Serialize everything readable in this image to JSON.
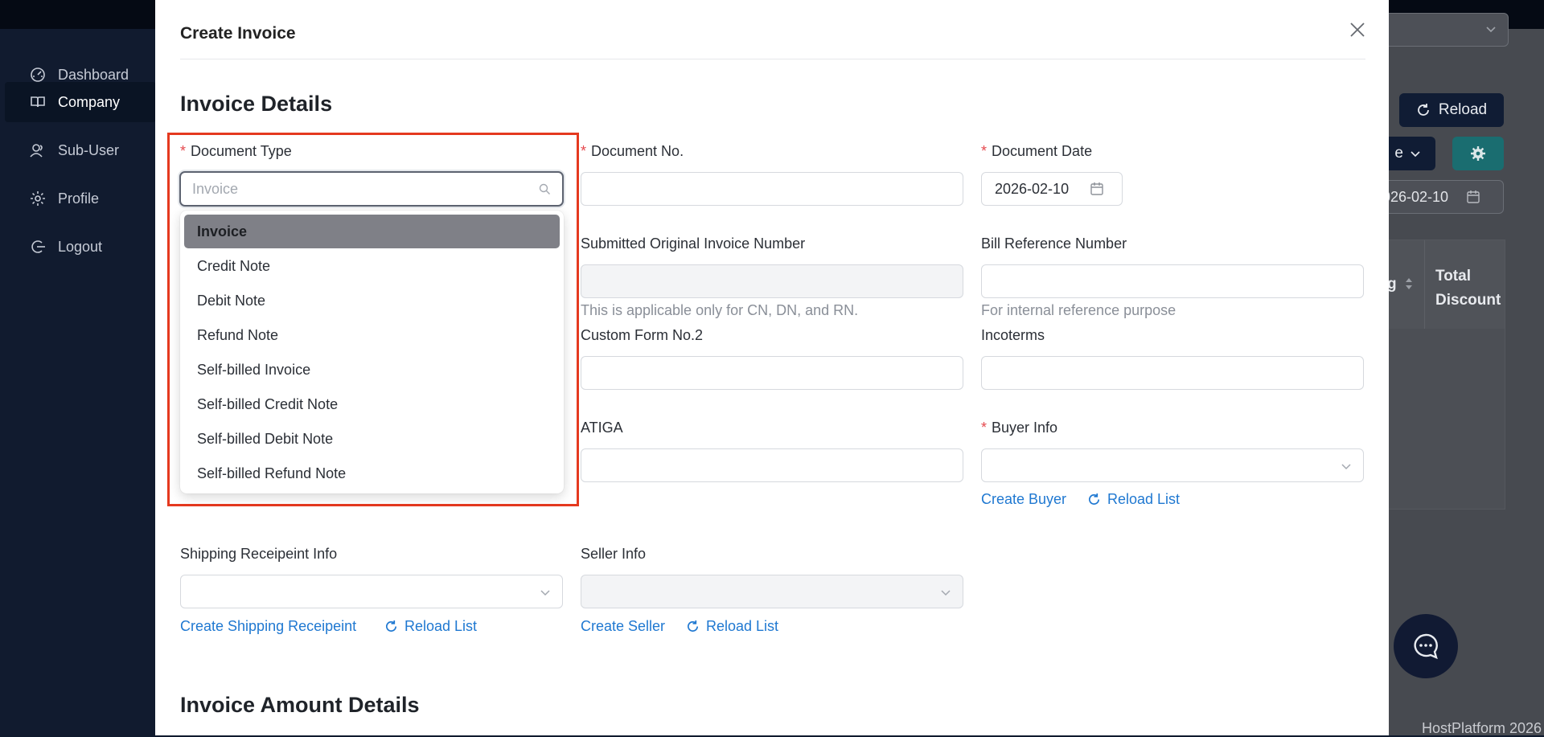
{
  "sidebar": {
    "items": [
      {
        "label": "Dashboard",
        "icon": "dashboard-icon"
      },
      {
        "label": "Company",
        "icon": "book-icon"
      },
      {
        "label": "Sub-User",
        "icon": "users-icon"
      },
      {
        "label": "Profile",
        "icon": "gear-icon"
      },
      {
        "label": "Logout",
        "icon": "logout-icon"
      }
    ],
    "active_index": 1
  },
  "background": {
    "reload_label": "Reload",
    "button_partial_label": "e",
    "date_partial": "026-02-10",
    "table_header_partial": "g",
    "table_header_total_discount": "Total Discount",
    "footer_text": "HostPlatform 2026"
  },
  "modal": {
    "title": "Create Invoice",
    "section_details": "Invoice Details",
    "section_amount": "Invoice Amount Details",
    "document_type": {
      "label": "Document Type",
      "placeholder": "Invoice",
      "options": [
        "Invoice",
        "Credit Note",
        "Debit Note",
        "Refund Note",
        "Self-billed Invoice",
        "Self-billed Credit Note",
        "Self-billed Debit Note",
        "Self-billed Refund Note"
      ],
      "selected_index": 0
    },
    "document_no": {
      "label": "Document No.",
      "value": ""
    },
    "document_date": {
      "label": "Document Date",
      "value": "2026-02-10"
    },
    "submitted_original": {
      "label": "Submitted Original Invoice Number",
      "hint": "This is applicable only for CN, DN, and RN."
    },
    "bill_reference": {
      "label": "Bill Reference Number",
      "hint": "For internal reference purpose"
    },
    "custom_form": {
      "label": "Custom Form No.2"
    },
    "incoterms": {
      "label": "Incoterms"
    },
    "atiga": {
      "label": "ATIGA"
    },
    "buyer_info": {
      "label": "Buyer Info",
      "create_link": "Create Buyer",
      "reload_link": "Reload List"
    },
    "shipping_info": {
      "label": "Shipping Receipeint Info",
      "create_link": "Create Shipping Receipeint",
      "reload_link": "Reload List"
    },
    "seller_info": {
      "label": "Seller Info",
      "create_link": "Create Seller",
      "reload_link": "Reload List"
    }
  },
  "colors": {
    "accent_link": "#1f78d1",
    "required_marker": "#e5484d",
    "highlight_box": "#e5391f",
    "sidebar_bg": "#111b2f"
  }
}
